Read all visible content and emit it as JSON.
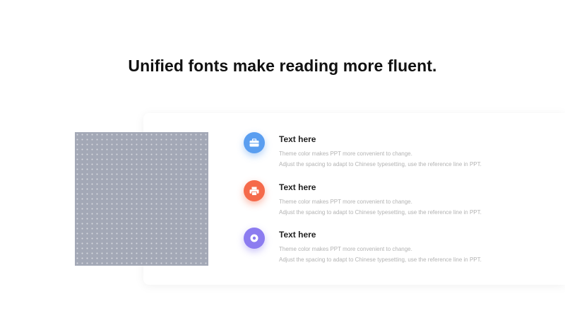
{
  "slide": {
    "title": "Unified fonts make reading more fluent.",
    "items": [
      {
        "title": "Text here",
        "line1": "Theme  color makes PPT more convenient to change.",
        "line2": "Adjust the spacing to adapt to Chinese typesetting, use the reference line in PPT.",
        "icon": "briefcase-icon",
        "color": "#5a9ef0"
      },
      {
        "title": "Text here",
        "line1": "Theme  color makes PPT more convenient to change.",
        "line2": "Adjust the spacing to adapt to Chinese typesetting, use the reference line in PPT.",
        "icon": "printer-icon",
        "color": "#f56a4a"
      },
      {
        "title": "Text here",
        "line1": "Theme  color makes PPT more convenient to change.",
        "line2": "Adjust the spacing to adapt to Chinese typesetting, use the reference line in PPT.",
        "icon": "location-pin-icon",
        "color": "#8c7cf0"
      }
    ]
  }
}
